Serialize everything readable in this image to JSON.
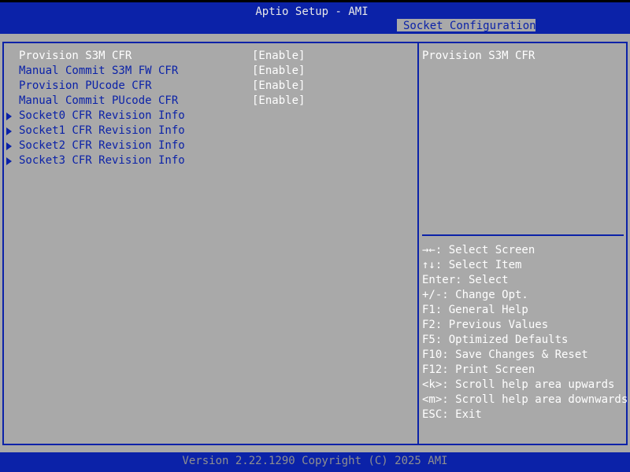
{
  "header": {
    "title": "Aptio Setup - AMI",
    "tab_label": "Socket Configuration"
  },
  "menu": {
    "settings": [
      {
        "label": "Provision S3M CFR",
        "value": "[Enable]"
      },
      {
        "label": "Manual Commit S3M FW CFR",
        "value": "[Enable]"
      },
      {
        "label": "Provision PUcode CFR",
        "value": "[Enable]"
      },
      {
        "label": "Manual Commit PUcode CFR",
        "value": "[Enable]"
      }
    ],
    "submenus": [
      {
        "label": "Socket0 CFR Revision Info"
      },
      {
        "label": "Socket1 CFR Revision Info"
      },
      {
        "label": "Socket2 CFR Revision Info"
      },
      {
        "label": "Socket3 CFR Revision Info"
      }
    ]
  },
  "help": {
    "description": "Provision S3M CFR",
    "keys": [
      "→←: Select Screen",
      "↑↓: Select Item",
      "Enter: Select",
      "+/-: Change Opt.",
      "F1: General Help",
      "F2: Previous Values",
      "F5: Optimized Defaults",
      "F10: Save Changes & Reset",
      "F12: Print Screen",
      "<k>: Scroll help area upwards",
      "<m>: Scroll help area downwards",
      "ESC: Exit"
    ]
  },
  "footer": {
    "text": "Version 2.22.1290 Copyright (C) 2025 AMI"
  },
  "colors": {
    "bios_blue": "#0b22a8",
    "panel_gray": "#a9a9a9",
    "text_white": "#ffffff"
  }
}
